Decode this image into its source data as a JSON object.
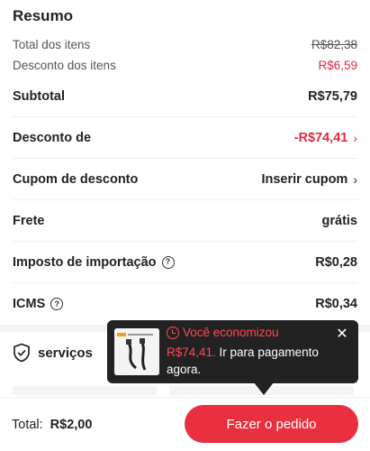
{
  "title": "Resumo",
  "summary": {
    "total_itens_label": "Total dos itens",
    "total_itens_value": "R$82,38",
    "desconto_itens_label": "Desconto dos itens",
    "desconto_itens_value": "R$6,59"
  },
  "rows": {
    "subtotal_label": "Subtotal",
    "subtotal_value": "R$75,79",
    "desconto_label": "Desconto de",
    "desconto_value": "-R$74,41",
    "cupom_label": "Cupom de desconto",
    "cupom_value": "Inserir cupom",
    "frete_label": "Frete",
    "frete_value": "grátis",
    "imposto_label": "Imposto de importação",
    "imposto_value": "R$0,28",
    "icms_label": "ICMS",
    "icms_value": "R$0,34"
  },
  "services": {
    "label": "serviços"
  },
  "footer": {
    "total_label": "Total:",
    "total_value": "R$2,00",
    "order_button": "Fazer o pedido"
  },
  "tooltip": {
    "heading": "Você economizou",
    "amount": "R$74,41.",
    "message": " Ir para pagamento agora.",
    "close": "✕"
  },
  "colors": {
    "accent": "#e8303f",
    "discount_red": "#e02b45",
    "tooltip_bg": "#222222"
  },
  "icons": [
    "info-icon",
    "shield-icon",
    "chevron-right-icon",
    "clock-icon",
    "close-icon"
  ]
}
